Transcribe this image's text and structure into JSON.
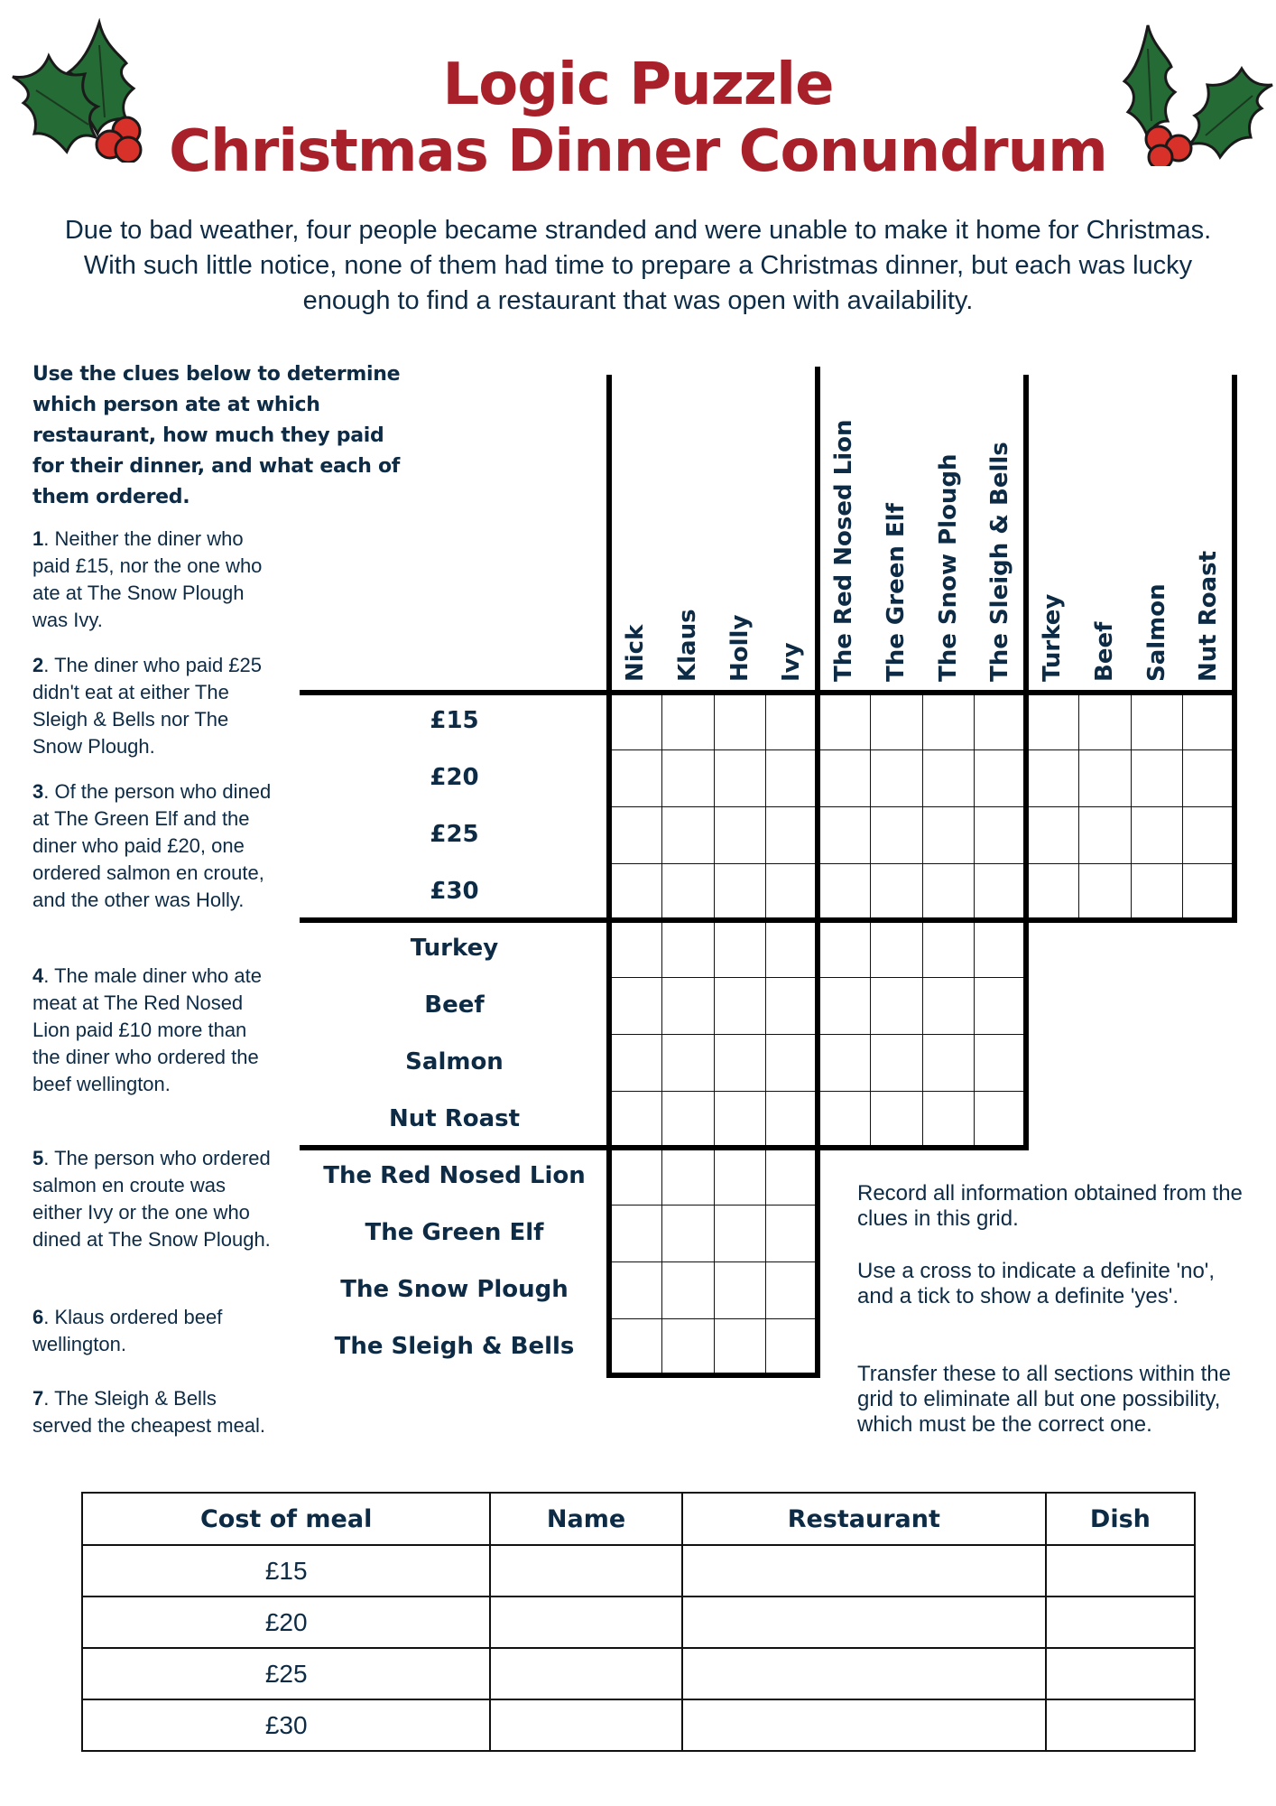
{
  "header": {
    "title_line1": "Logic Puzzle",
    "title_line2": "Christmas Dinner Conundrum",
    "title_color": "#a8202a",
    "decoration_icon": "holly-icon"
  },
  "intro": "Due to bad weather, four people became stranded and were unable to make it home for Christmas. With such little notice, none of them had time to prepare a Christmas dinner, but each was lucky enough to find a restaurant that was open with availability.",
  "instructions": "Use the clues below to determine which person ate at which restaurant, how much they paid for their dinner, and what each of them ordered.",
  "clues": [
    {
      "num": "1",
      "text": ". Neither the diner who paid £15, nor the one who ate at The Snow Plough was Ivy."
    },
    {
      "num": "2",
      "text": ". The diner who paid £25 didn't eat at either The Sleigh & Bells nor The Snow Plough."
    },
    {
      "num": "3",
      "text": ". Of the person who dined at The Green Elf and the diner who paid £20, one ordered salmon en croute, and the other was Holly."
    },
    {
      "num": "4",
      "text": ". The male diner who ate meat at The Red Nosed Lion paid £10 more than the diner who ordered the beef wellington."
    },
    {
      "num": "5",
      "text": ". The person who ordered salmon en croute was either Ivy or the one who dined at The Snow Plough."
    },
    {
      "num": "6",
      "text": ". Klaus ordered beef wellington."
    },
    {
      "num": "7",
      "text": ". The Sleigh & Bells served the cheapest meal."
    }
  ],
  "grid": {
    "column_groups": [
      {
        "name": "names",
        "labels": [
          "Nick",
          "Klaus",
          "Holly",
          "Ivy"
        ]
      },
      {
        "name": "restaurants",
        "labels": [
          "The Red Nosed Lion",
          "The Green Elf",
          "The Snow Plough",
          "The Sleigh & Bells"
        ]
      },
      {
        "name": "dishes",
        "labels": [
          "Turkey",
          "Beef",
          "Salmon",
          "Nut Roast"
        ]
      }
    ],
    "row_groups": [
      {
        "name": "costs",
        "labels": [
          "£15",
          "£20",
          "£25",
          "£30"
        ],
        "blocks": 3
      },
      {
        "name": "dishes",
        "labels": [
          "Turkey",
          "Beef",
          "Salmon",
          "Nut Roast"
        ],
        "blocks": 2
      },
      {
        "name": "restaurants",
        "labels": [
          "The Red Nosed Lion",
          "The Green Elf",
          "The Snow Plough",
          "The Sleigh & Bells"
        ],
        "blocks": 1
      }
    ]
  },
  "notes": [
    "Record all information obtained from the clues in this grid.",
    "Use a cross to indicate a definite 'no', and a tick to show a definite 'yes'.",
    "Transfer these to all sections within the grid to eliminate all but one possibility, which must be the correct one."
  ],
  "answer_table": {
    "headers": [
      "Cost of meal",
      "Name",
      "Restaurant",
      "Dish"
    ],
    "rows": [
      [
        "£15",
        "",
        "",
        ""
      ],
      [
        "£20",
        "",
        "",
        ""
      ],
      [
        "£25",
        "",
        "",
        ""
      ],
      [
        "£30",
        "",
        "",
        ""
      ]
    ]
  }
}
